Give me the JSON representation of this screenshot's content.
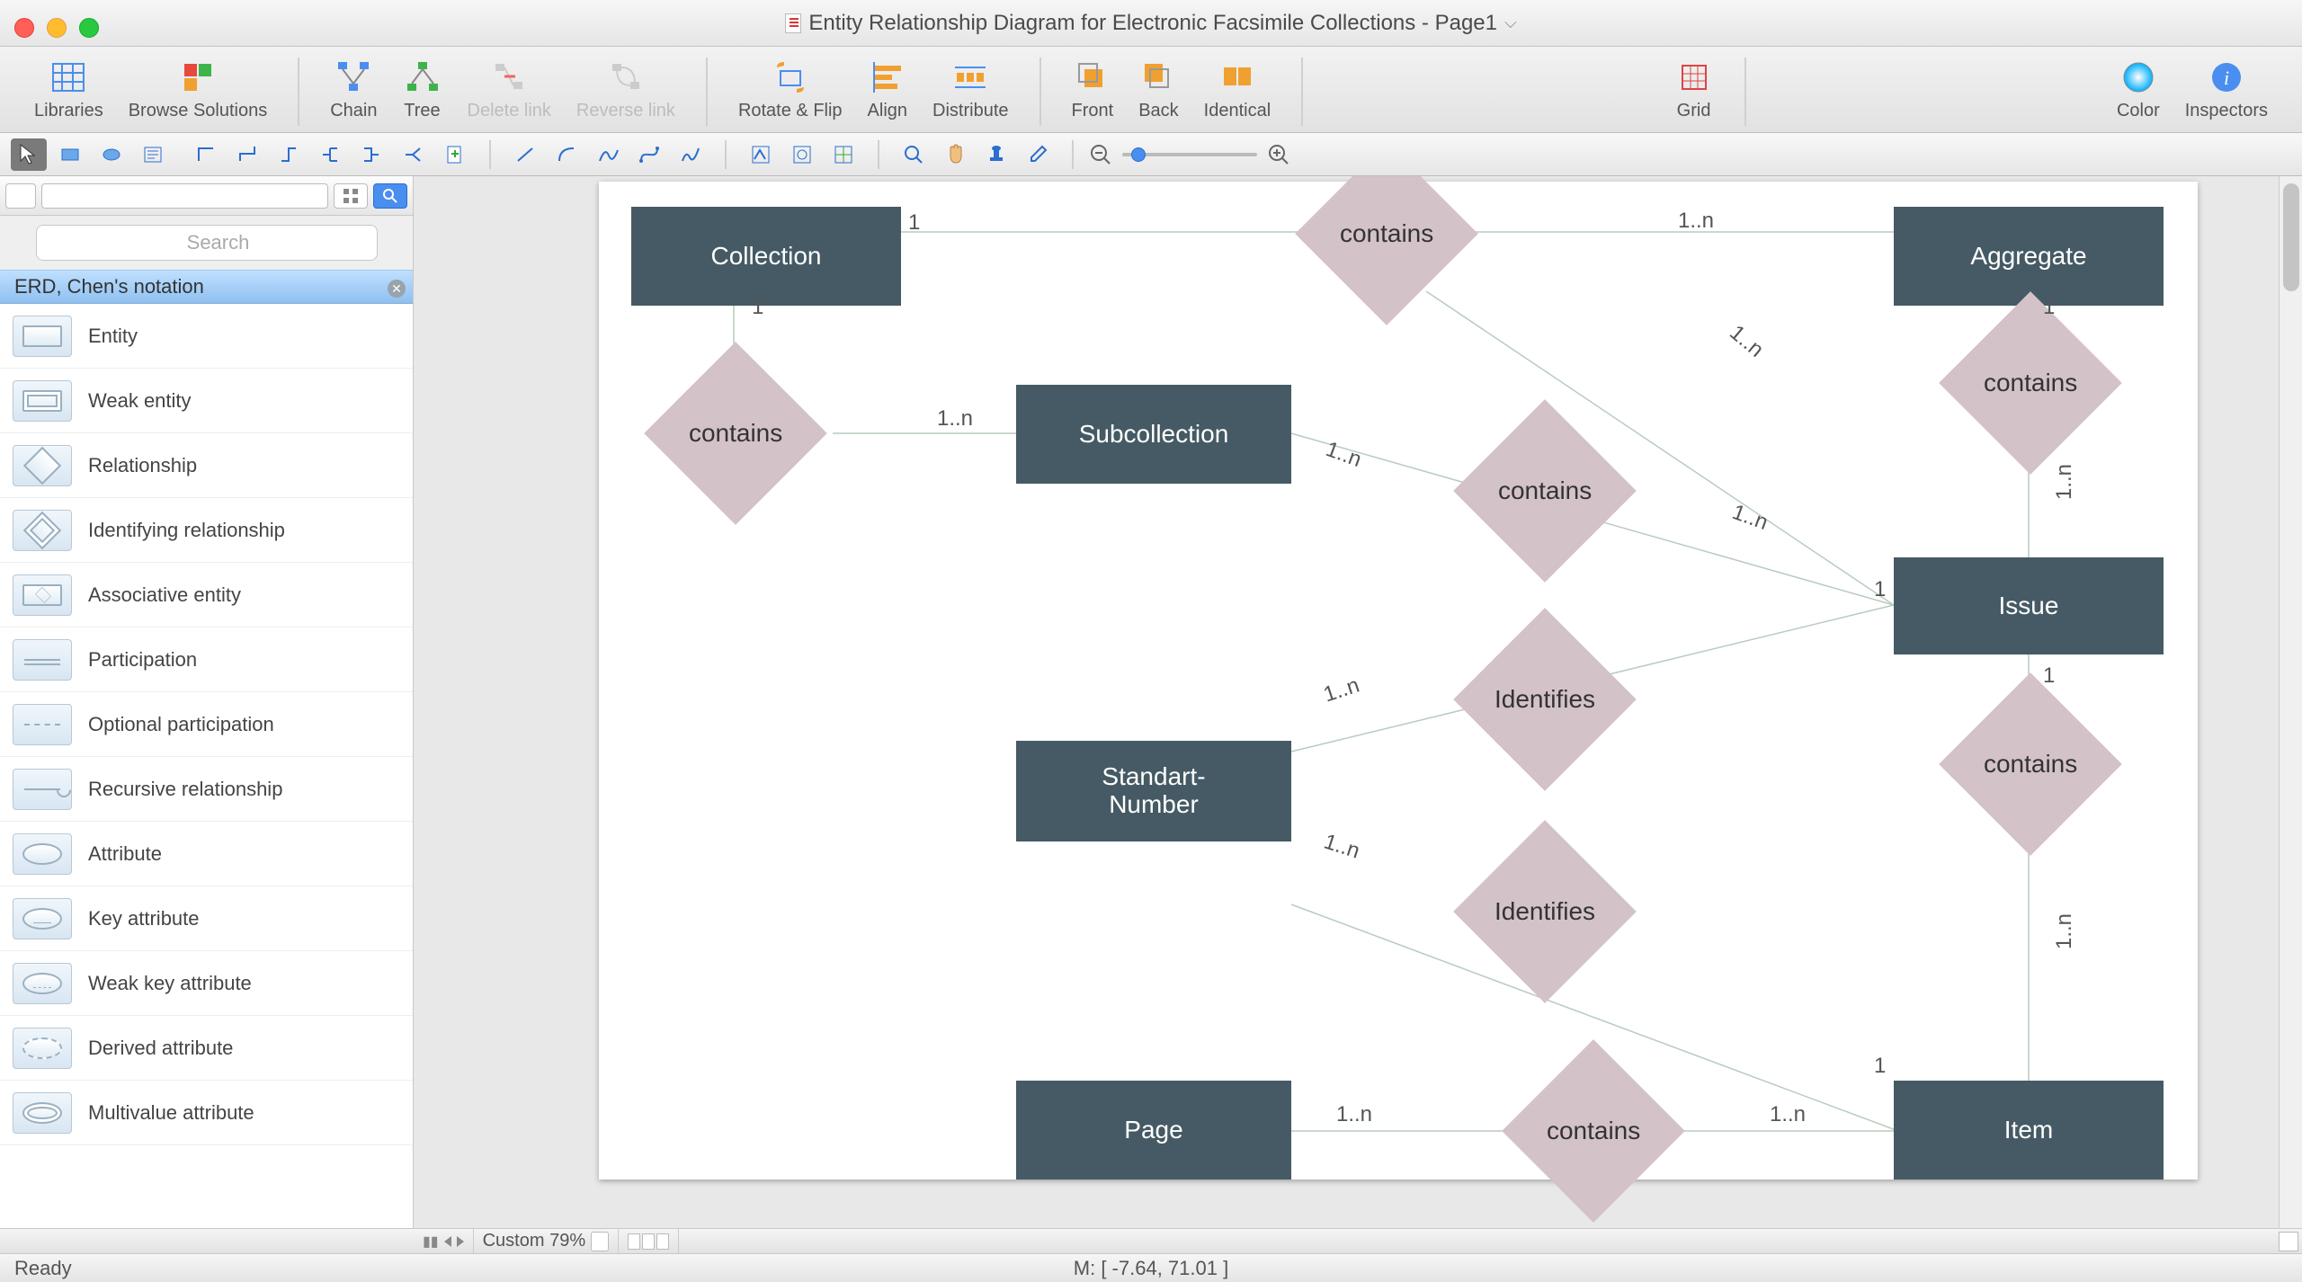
{
  "window": {
    "title": "Entity Relationship Diagram for Electronic Facsimile Collections - Page1"
  },
  "toolbar": {
    "libraries": "Libraries",
    "browse_solutions": "Browse Solutions",
    "chain": "Chain",
    "tree": "Tree",
    "delete_link": "Delete link",
    "reverse_link": "Reverse link",
    "rotate_flip": "Rotate & Flip",
    "align": "Align",
    "distribute": "Distribute",
    "front": "Front",
    "back": "Back",
    "identical": "Identical",
    "grid": "Grid",
    "color": "Color",
    "inspectors": "Inspectors"
  },
  "sidebar": {
    "search_placeholder": "Search",
    "stencil_title": "ERD, Chen's notation",
    "items": [
      "Entity",
      "Weak entity",
      "Relationship",
      "Identifying relationship",
      "Associative entity",
      "Participation",
      "Optional participation",
      "Recursive relationship",
      "Attribute",
      "Key attribute",
      "Weak key attribute",
      "Derived attribute",
      "Multivalue attribute"
    ]
  },
  "diagram": {
    "entities": {
      "collection": "Collection",
      "aggregate": "Aggregate",
      "subcollection": "Subcollection",
      "issue": "Issue",
      "standart_number": "Standart-\nNumber",
      "page": "Page",
      "item": "Item"
    },
    "relationships": {
      "contains1": "contains",
      "contains2": "contains",
      "contains3": "contains",
      "contains4": "contains",
      "contains5": "contains",
      "contains6": "contains",
      "identifies1": "Identifies",
      "identifies2": "Identifies"
    },
    "cardinalities": {
      "c1": "1",
      "c2": "1..n",
      "c3": "1",
      "c4": "1",
      "c5": "1..n",
      "c6": "1..n",
      "c7": "1..n",
      "c8": "1",
      "c9": "1..n",
      "c10": "1",
      "c11": "1..n",
      "c12": "1..n",
      "c13": "1..n",
      "c14": "1",
      "c15": "1..n",
      "c16": "1..n"
    }
  },
  "bottombar": {
    "zoom_label": "Custom 79%"
  },
  "status": {
    "ready": "Ready",
    "mouse": "M: [ -7.64, 71.01 ]"
  }
}
